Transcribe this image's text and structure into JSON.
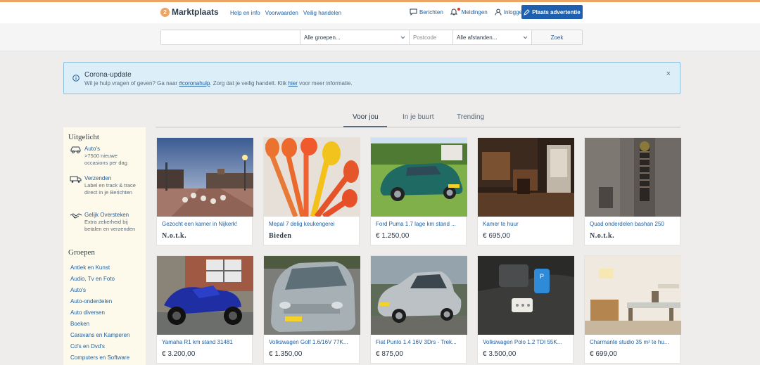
{
  "brand": {
    "badge": "2",
    "name": "Marktplaats",
    "accent": "#eda566"
  },
  "header": {
    "links": [
      "Help en info",
      "Voorwaarden",
      "Veilig handelen"
    ],
    "messages": "Berichten",
    "notifications": "Meldingen",
    "login": "Inloggen",
    "place_ad": "Plaats advertentie"
  },
  "search": {
    "query_placeholder": "",
    "category": "Alle groepen...",
    "postcode_placeholder": "Postcode",
    "distance": "Alle afstanden...",
    "button": "Zoek"
  },
  "banner": {
    "title": "Corona-update",
    "text_before": "Wil je hulp vragen of geven? Ga naar ",
    "link1": "#coronahulp",
    "text_middle": ". Zorg dat je veilig handelt. Klik ",
    "link2": "hier",
    "text_after": " voor meer informatie.",
    "close": "×"
  },
  "tabs": [
    "Voor jou",
    "In je buurt",
    "Trending"
  ],
  "sidebar": {
    "featured_title": "Uitgelicht",
    "featured": [
      {
        "icon": "car-icon",
        "title": "Auto's",
        "desc": ">7500 nieuwe occasions per dag"
      },
      {
        "icon": "truck-icon",
        "title": "Verzenden",
        "desc": "Label en track & trace direct in je Berichten"
      },
      {
        "icon": "handshake-icon",
        "title": "Gelijk Oversteken",
        "desc": "Extra zekerheid bij betalen en verzenden"
      }
    ],
    "groups_title": "Groepen",
    "groups": [
      "Antiek en Kunst",
      "Audio, Tv en Foto",
      "Auto's",
      "Auto-onderdelen",
      "Auto diversen",
      "Boeken",
      "Caravans en Kamperen",
      "Cd's en Dvd's",
      "Computers en Software"
    ]
  },
  "listings": [
    {
      "title": "Gezocht een kamer in Nijkerk!",
      "price": "N.o.t.k."
    },
    {
      "title": "Mepal 7 delig keukengerei",
      "price": "Bieden"
    },
    {
      "title": "Ford Puma 1.7 lage km stand ...",
      "price": "€ 1.250,00"
    },
    {
      "title": "Kamer te huur",
      "price": "€ 695,00"
    },
    {
      "title": "Quad onderdelen bashan 250",
      "price": "N.o.t.k."
    },
    {
      "title": "Yamaha R1 km stand 31481",
      "price": "€ 3.200,00"
    },
    {
      "title": "Volkswagen Golf 1.6/16V 77K...",
      "price": "€ 1.350,00"
    },
    {
      "title": "Fiat Punto 1.4 16V 3Drs - Trek...",
      "price": "€ 875,00"
    },
    {
      "title": "Volkswagen Polo 1.2 TDI 55K...",
      "price": "€ 3.500,00"
    },
    {
      "title": "Charmante studio 35 m² te hu...",
      "price": "€ 699,00"
    }
  ]
}
